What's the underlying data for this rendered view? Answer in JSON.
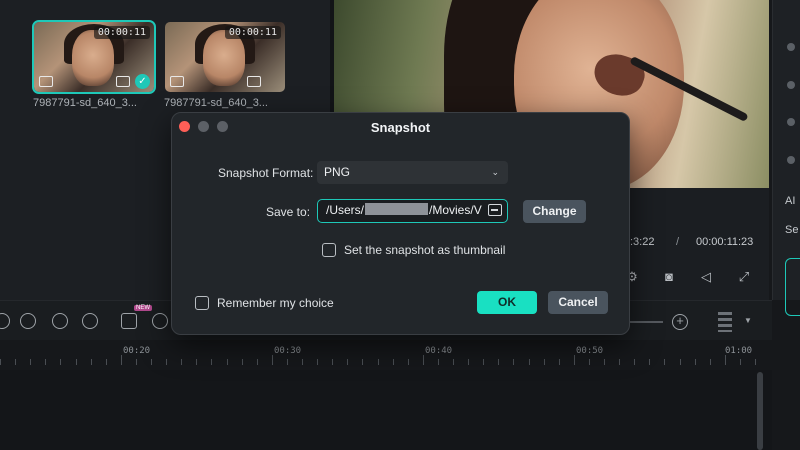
{
  "media": {
    "clips": [
      {
        "name": "7987791-sd_640_3...",
        "duration": "00:00:11",
        "selected": true
      },
      {
        "name": "7987791-sd_640_3...",
        "duration": "00:00:11",
        "selected": false
      }
    ]
  },
  "player": {
    "current_time": ":3:22",
    "separator": "/",
    "total_time": "00:00:11:23"
  },
  "right_panel": {
    "ai_label": "AI",
    "se_label": "Se"
  },
  "timeline": {
    "new_badge": "NEW",
    "ruler_labels": [
      "00:20",
      "00:30",
      "00:40",
      "00:50",
      "01:00"
    ]
  },
  "dialog": {
    "title": "Snapshot",
    "format_label": "Snapshot Format:",
    "format_value": "PNG",
    "save_to_label": "Save to:",
    "path_prefix": "/Users/",
    "path_suffix": "/Movies/V",
    "change_button": "Change",
    "thumbnail_checkbox_label": "Set the snapshot as thumbnail",
    "thumbnail_checked": false,
    "remember_checkbox_label": "Remember my choice",
    "remember_checked": false,
    "ok_button": "OK",
    "cancel_button": "Cancel"
  },
  "colors": {
    "accent": "#1ec8b8",
    "ok_button": "#19e0c2",
    "close_traffic_light": "#fe5f57",
    "dialog_bg": "#22262a"
  }
}
